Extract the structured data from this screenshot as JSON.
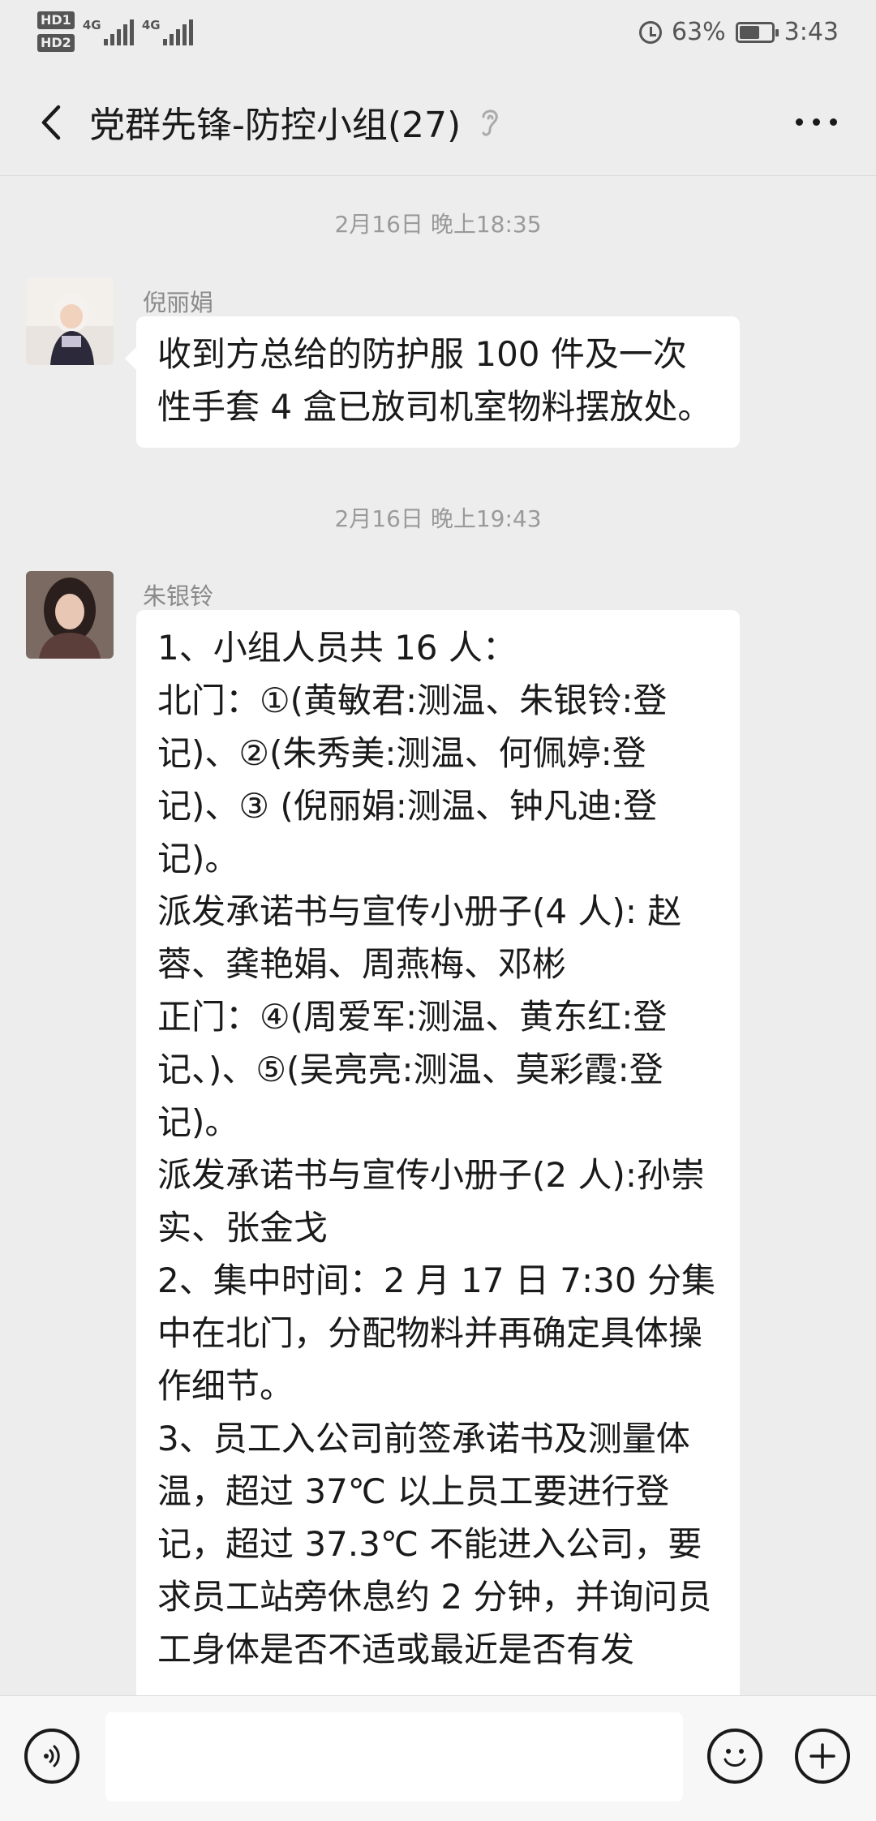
{
  "status_bar": {
    "hd1": "HD1",
    "hd2": "HD2",
    "net1": "4G",
    "net2": "4G",
    "battery_percent": "63%",
    "battery_level": 0.63,
    "time": "3:43"
  },
  "header": {
    "title": "党群先锋-防控小组(27)",
    "back_icon": "chevron-left-icon",
    "mute_icon": "ear-icon",
    "more_icon": "more-dots-icon"
  },
  "messages": [
    {
      "timestamp": "2月16日 晚上18:35",
      "sender": "倪丽娟",
      "text": "收到方总给的防护服 100 件及一次性手套 4 盒已放司机室物料摆放处。"
    },
    {
      "timestamp": "2月16日 晚上19:43",
      "sender": "朱银铃",
      "text": "1、小组人员共 16 人：\n北门：①(黄敏君:测温、朱银铃:登记)、②(朱秀美:测温、何佩婷:登记)、③ (倪丽娟:测温、钟凡迪:登记)。\n派发承诺书与宣传小册子(4 人): 赵蓉、龚艳娟、周燕梅、邓彬\n正门：④(周爱军:测温、黄东红:登记、)、⑤(吴亮亮:测温、莫彩霞:登记)。\n派发承诺书与宣传小册子(2 人):孙崇实、张金戈\n2、集中时间：2 月 17 日 7:30 分集中在北门，分配物料并再确定具体操作细节。\n3、员工入公司前签承诺书及测量体温，超过 37℃ 以上员工要进行登记，超过 37.3℃ 不能进入公司，要求员工站旁休息约 2 分钟，并询问员工身体是否不适或最近是否有发"
    }
  ],
  "input_bar": {
    "voice_icon": "voice-icon",
    "emoji_icon": "emoji-icon",
    "plus_icon": "plus-icon"
  }
}
